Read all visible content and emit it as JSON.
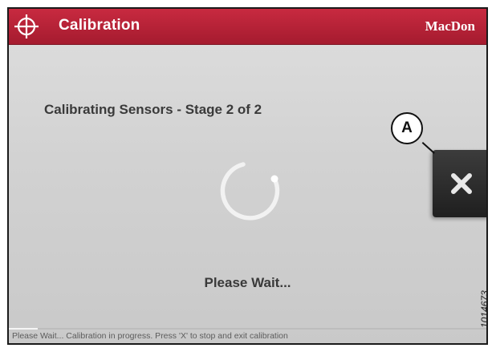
{
  "header": {
    "title": "Calibration",
    "brand": "MacDon",
    "icon": "crosshair-icon",
    "color": "#b8213a"
  },
  "main": {
    "heading": "Calibrating Sensors - Stage 2 of 2",
    "wait_text": "Please Wait...",
    "spinner_icon": "loading-spinner-icon"
  },
  "exit_button": {
    "icon": "close-icon",
    "label": "X"
  },
  "callout": {
    "label": "A"
  },
  "footer": {
    "status_text": "Please Wait... Calibration in progress. Press 'X' to stop and exit calibration",
    "progress_fraction": 0.06
  },
  "figure_number": "1014673"
}
